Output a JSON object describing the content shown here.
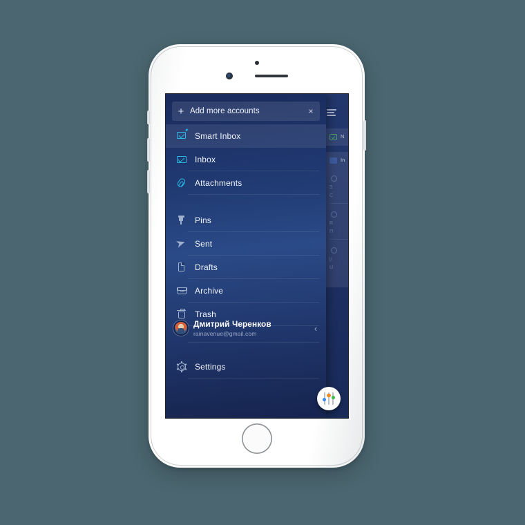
{
  "canvas": {
    "background_color": "#4b6670"
  },
  "device": {
    "name": "white-smartphone",
    "body_color": "#ffffff",
    "screen_background": "#1b2f62"
  },
  "app": {
    "drawer": {
      "add_accounts": {
        "plus_icon": "plus-icon",
        "label": "Add more accounts",
        "close_icon": "×"
      },
      "items": [
        {
          "label": "Smart Inbox",
          "icon": "smart-inbox-icon",
          "active": true,
          "accent": "#29b8e8"
        },
        {
          "label": "Inbox",
          "icon": "envelope-icon",
          "active": false,
          "accent": "#29b8e8"
        },
        {
          "label": "Attachments",
          "icon": "paperclip-icon",
          "active": false,
          "accent": "#29b8e8"
        },
        {
          "label": "Pins",
          "icon": "pin-icon",
          "active": false,
          "accent": "#9fb0cd"
        },
        {
          "label": "Sent",
          "icon": "send-icon",
          "active": false,
          "accent": "#9fb0cd"
        },
        {
          "label": "Drafts",
          "icon": "document-icon",
          "active": false,
          "accent": "#9fb0cd"
        },
        {
          "label": "Archive",
          "icon": "archive-icon",
          "active": false,
          "accent": "#9fb0cd"
        },
        {
          "label": "Trash",
          "icon": "trash-icon",
          "active": false,
          "accent": "#9fb0cd"
        }
      ],
      "account": {
        "name": "Дмитрий Черенков",
        "email": "rainavenue@gmail.com",
        "collapse_icon": "‹",
        "avatar": "user-avatar"
      },
      "settings": {
        "label": "Settings",
        "icon": "gear-icon"
      },
      "fab": {
        "name": "filter-sliders-button",
        "dot_colors": [
          "#3d8bf0",
          "#f08a1e",
          "#3dbb45"
        ]
      }
    },
    "mail_panel": {
      "menu_icon": "hamburger-menu-icon",
      "card_one_letter": "N",
      "card_two_letter": "In",
      "rows": [
        {
          "line1": "З",
          "line2": "С"
        },
        {
          "line1": "R",
          "line2": "П"
        },
        {
          "line1": "[i",
          "line2": "U"
        }
      ]
    }
  }
}
